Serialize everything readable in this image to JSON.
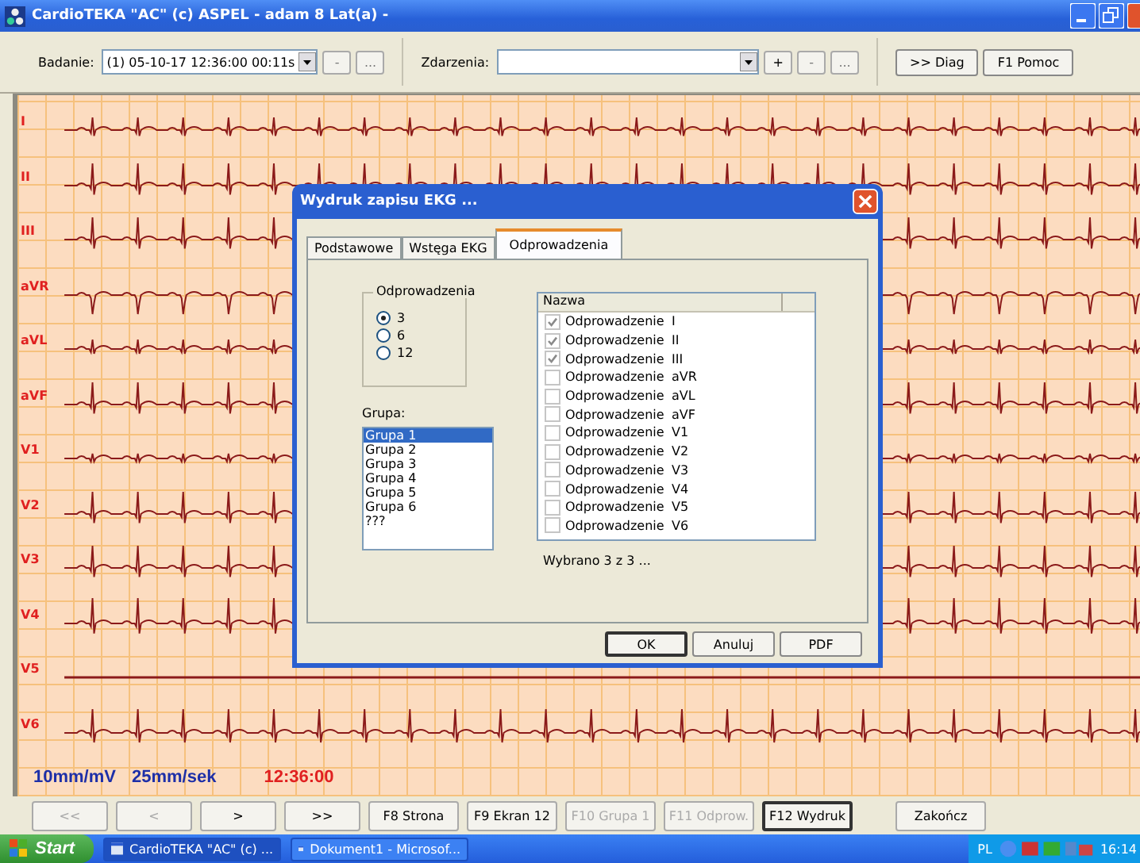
{
  "window": {
    "title": "CardioTEKA \"AC\" (c) ASPEL - adam  8 Lat(a) -"
  },
  "toolbar": {
    "exam_label": "Badanie:",
    "exam_value": "(1) 05-10-17 12:36:00  00:11s",
    "exam_buttons": [
      "-",
      "..."
    ],
    "events_label": "Zdarzenia:",
    "event_buttons": [
      "+",
      "-",
      "..."
    ],
    "buttons": [
      ">> Diag",
      "F1 Pomoc"
    ]
  },
  "leads": [
    {
      "label": "I",
      "flat": false
    },
    {
      "label": "II",
      "flat": false
    },
    {
      "label": "III",
      "flat": false
    },
    {
      "label": "aVR",
      "flat": false
    },
    {
      "label": "aVL",
      "flat": false
    },
    {
      "label": "aVF",
      "flat": false
    },
    {
      "label": "V1",
      "flat": false
    },
    {
      "label": "V2",
      "flat": false
    },
    {
      "label": "V3",
      "flat": false
    },
    {
      "label": "V4",
      "flat": false
    },
    {
      "label": "V5",
      "flat": true
    },
    {
      "label": "V6",
      "flat": false
    }
  ],
  "scale": {
    "gain": "10mm/mV",
    "speed": "25mm/sek",
    "time": "12:36:00"
  },
  "dialog": {
    "title": "Wydruk zapisu EKG ...",
    "tabs": [
      {
        "label": "Podstawowe",
        "selected": false
      },
      {
        "label": "Wstęga EKG",
        "selected": false
      },
      {
        "label": "Odprowadzenia",
        "selected": true
      }
    ],
    "group_title": "Odprowadzenia",
    "radios": [
      {
        "label": "3",
        "selected": true
      },
      {
        "label": "6",
        "selected": false
      },
      {
        "label": "12",
        "selected": false
      }
    ],
    "list_label": "Grupa:",
    "groups": [
      {
        "label": "Grupa 1",
        "selected": true
      },
      {
        "label": "Grupa 2",
        "selected": false
      },
      {
        "label": "Grupa 3",
        "selected": false
      },
      {
        "label": "Grupa 4",
        "selected": false
      },
      {
        "label": "Grupa 5",
        "selected": false
      },
      {
        "label": "Grupa 6",
        "selected": false
      },
      {
        "label": "???",
        "selected": false
      }
    ],
    "table_header": "Nazwa",
    "rows": [
      {
        "name": "Odprowadzenie",
        "lead": "I",
        "checked": true
      },
      {
        "name": "Odprowadzenie",
        "lead": "II",
        "checked": true
      },
      {
        "name": "Odprowadzenie",
        "lead": "III",
        "checked": true
      },
      {
        "name": "Odprowadzenie",
        "lead": "aVR",
        "checked": false
      },
      {
        "name": "Odprowadzenie",
        "lead": "aVL",
        "checked": false
      },
      {
        "name": "Odprowadzenie",
        "lead": "aVF",
        "checked": false
      },
      {
        "name": "Odprowadzenie",
        "lead": "V1",
        "checked": false
      },
      {
        "name": "Odprowadzenie",
        "lead": "V2",
        "checked": false
      },
      {
        "name": "Odprowadzenie",
        "lead": "V3",
        "checked": false
      },
      {
        "name": "Odprowadzenie",
        "lead": "V4",
        "checked": false
      },
      {
        "name": "Odprowadzenie",
        "lead": "V5",
        "checked": false
      },
      {
        "name": "Odprowadzenie",
        "lead": "V6",
        "checked": false
      }
    ],
    "summary": "Wybrano 3 z 3  ...",
    "buttons": [
      {
        "label": "OK",
        "default": true
      },
      {
        "label": "Anuluj",
        "default": false
      },
      {
        "label": "PDF",
        "default": false
      }
    ]
  },
  "bottom_buttons": [
    {
      "label": "<<",
      "disabled": true,
      "default": false
    },
    {
      "label": "<",
      "disabled": true,
      "default": false
    },
    {
      "label": ">",
      "disabled": false,
      "default": false
    },
    {
      "label": ">>",
      "disabled": false,
      "default": false
    },
    {
      "label": "F8 Strona",
      "disabled": false,
      "default": false
    },
    {
      "label": "F9  Ekran 12",
      "disabled": false,
      "default": false
    },
    {
      "label": "F10  Grupa 1",
      "disabled": true,
      "default": false
    },
    {
      "label": "F11  Odprow.",
      "disabled": true,
      "default": false
    },
    {
      "label": "F12 Wydruk",
      "disabled": false,
      "default": true
    },
    {
      "label": "Zakończ",
      "disabled": false,
      "default": false
    }
  ],
  "taskbar": {
    "start": "Start",
    "tasks": [
      {
        "label": "CardioTEKA \"AC\" (c) ...",
        "selected": true
      },
      {
        "label": "Dokument1 - Microsof...",
        "selected": false
      }
    ],
    "language": "PL",
    "time": "16:14"
  }
}
